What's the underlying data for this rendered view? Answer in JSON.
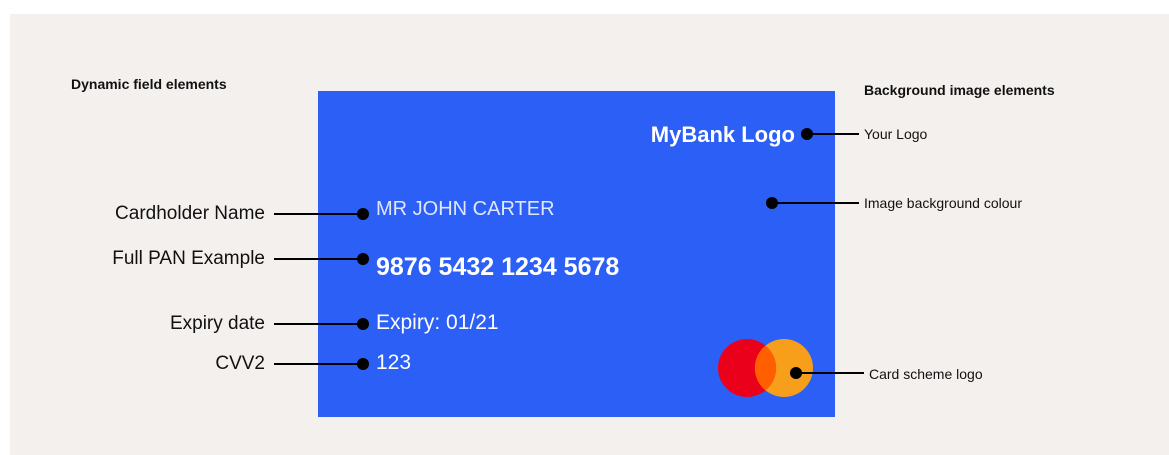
{
  "sections": {
    "dynamic_title": "Dynamic field elements",
    "background_title": "Background image elements"
  },
  "card": {
    "background_color": "#2b5ff5",
    "bank_logo": "MyBank Logo",
    "cardholder": "MR JOHN CARTER",
    "pan": "9876 5432 1234 5678",
    "expiry": "Expiry: 01/21",
    "cvv": "123",
    "scheme_logo": {
      "icon": "mastercard-logo-icon",
      "left_color": "#eb001b",
      "right_color": "#f79e1b",
      "overlap_color": "#ff5f00"
    }
  },
  "left_labels": {
    "cardholder": "Cardholder Name",
    "pan": "Full PAN Example",
    "expiry": "Expiry date",
    "cvv": "CVV2"
  },
  "right_labels": {
    "logo": "Your Logo",
    "background": "Image background colour",
    "scheme": "Card scheme logo"
  }
}
